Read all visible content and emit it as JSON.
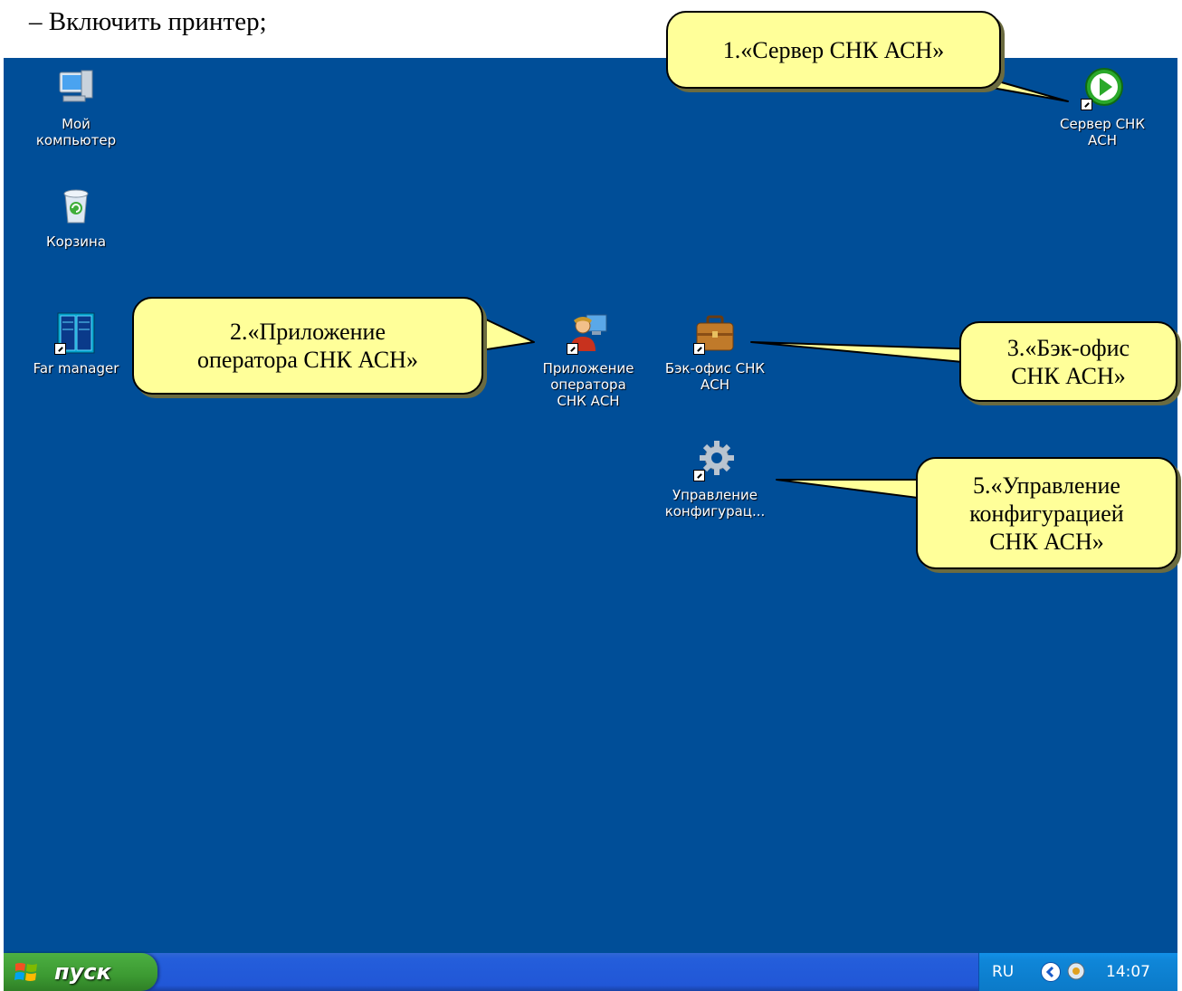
{
  "document": {
    "instruction_line": "– Включить принтер;"
  },
  "desktop": {
    "icons": [
      {
        "label": "Мой\nкомпьютер",
        "icon": "my-computer-icon"
      },
      {
        "label": "Корзина",
        "icon": "recycle-bin-icon"
      },
      {
        "label": "Far manager",
        "icon": "far-manager-icon"
      },
      {
        "label": "Приложение\nоператора\nСНК АСН",
        "icon": "operator-app-icon"
      },
      {
        "label": "Бэк-офис СНК\nАСН",
        "icon": "briefcase-icon"
      },
      {
        "label": "Управление\nконфигурац...",
        "icon": "gear-icon"
      },
      {
        "label": "Сервер СНК\nАСН",
        "icon": "play-server-icon"
      }
    ]
  },
  "callouts": [
    {
      "text": "1.«Сервер СНК АСН»"
    },
    {
      "text": "2.«Приложение\nоператора СНК АСН»"
    },
    {
      "text": "3.«Бэк-офис\nСНК АСН»"
    },
    {
      "text": "5.«Управление\nконфигурацией\nСНК АСН»"
    }
  ],
  "taskbar": {
    "start_label": "пуск",
    "language": "RU",
    "clock": "14:07"
  },
  "colors": {
    "desktop_background": "#004E98",
    "callout_fill": "#ffff99",
    "start_button": "#3c9a32"
  }
}
